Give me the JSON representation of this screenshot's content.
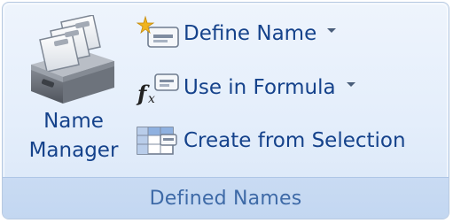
{
  "group": {
    "title": "Defined Names"
  },
  "name_manager": {
    "line1": "Name",
    "line2": "Manager",
    "icon": "name-manager-icon"
  },
  "define_name": {
    "label": "Define Name",
    "icon": "define-name-icon",
    "has_dropdown": true
  },
  "use_in_formula": {
    "label": "Use in Formula",
    "icon": "use-in-formula-icon",
    "has_dropdown": true
  },
  "create_from_selection": {
    "label": "Create from Selection",
    "icon": "create-from-selection-icon"
  },
  "colors": {
    "label_text": "#15428b",
    "group_title": "#3e6aa7",
    "group_bg": "#e4eefb",
    "footer_bg": "#c9dbf3"
  }
}
